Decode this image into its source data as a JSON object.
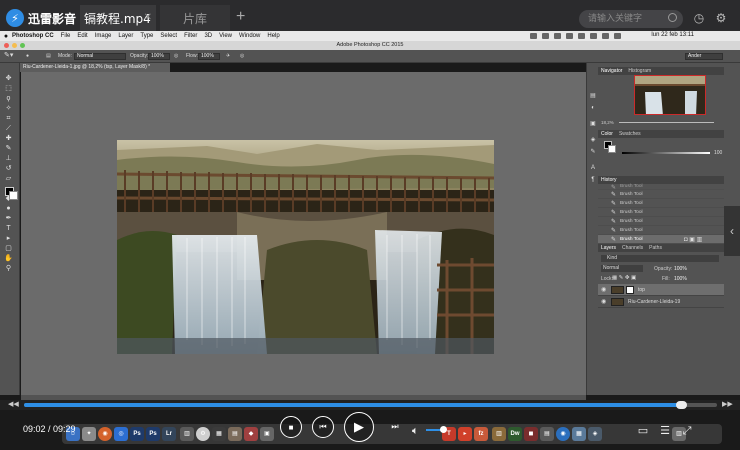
{
  "player": {
    "app_name": "迅雷影音",
    "tabs": [
      {
        "label": "镉教程.mp4",
        "active": true
      },
      {
        "label": "片库",
        "active": false
      }
    ],
    "search_placeholder": "请输入关键字",
    "icons": [
      "history-icon",
      "settings-icon",
      "minimize-icon"
    ],
    "current_time": "09:02 / 09:29",
    "progress_percent": 95,
    "volume_percent": 60,
    "accent_color": "#2e8fe6"
  },
  "menubar": {
    "app_name": "Photoshop CC",
    "items": [
      "File",
      "Edit",
      "Image",
      "Layer",
      "Type",
      "Select",
      "Filter",
      "3D",
      "View",
      "Window",
      "Help"
    ],
    "clock": "lun 22 feb 13:11"
  },
  "photoshop": {
    "window_title": "Adobe Photoshop CC 2015",
    "options": {
      "mode_label": "Mode:",
      "mode_value": "Normal",
      "opacity_label": "Opacity:",
      "opacity_value": "100%",
      "flow_label": "Flow:",
      "flow_value": "100%",
      "workspace": "Ander"
    },
    "doc_tab": "Riu-Cardener-Lleida-1.jpg @ 18,2% (tsp, Layer Mask/8) *",
    "panels": {
      "navigator_tabs": [
        "Navigator",
        "Histogram"
      ],
      "zoom_value": "18,2%",
      "color_tabs": [
        "Color",
        "Swatches"
      ],
      "color_slider_value": "100",
      "history_title": "History",
      "history_items": [
        "Brush Tool",
        "Brush Tool",
        "Brush Tool",
        "Brush Tool",
        "Brush Tool",
        "Brush Tool",
        "Brush Tool",
        "Brush Tool"
      ],
      "layers_tabs": [
        "Layers",
        "Channels",
        "Paths"
      ],
      "layers_filter": "Kind",
      "blend_mode": "Normal",
      "opacity_label": "Opacity:",
      "opacity_value": "100%",
      "lock_label": "Lock:",
      "fill_label": "Fill:",
      "fill_value": "100%",
      "layers": [
        {
          "name": "top",
          "selected": true
        },
        {
          "name": "Riu-Cardener-Lleida-19",
          "selected": false
        }
      ]
    }
  }
}
